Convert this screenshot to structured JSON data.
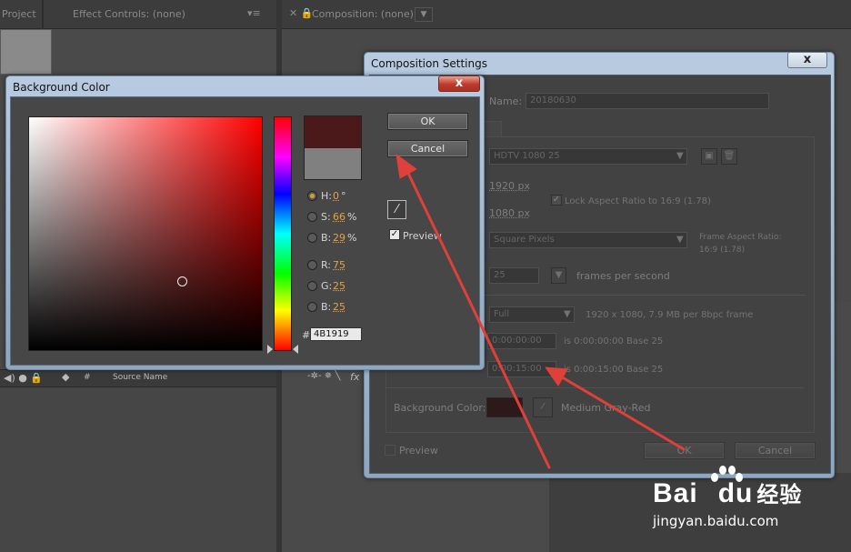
{
  "app": {
    "tabs": {
      "project": "Project",
      "effect_controls": "Effect Controls: (none)",
      "composition": "Composition: (none)"
    },
    "timeline": {
      "hash": "#",
      "source_name": "Source Name",
      "fx": "fx"
    }
  },
  "comp_settings": {
    "title": "Composition Settings",
    "close": "x",
    "name_label": "Name:",
    "name_value": "20180630",
    "preset": "HDTV 1080 25",
    "width": "1920 px",
    "height": "1080 px",
    "lock_aspect": "Lock Aspect Ratio to 16:9 (1.78)",
    "pixel_aspect": "Square Pixels",
    "frame_aspect_label": "Frame Aspect Ratio:",
    "frame_aspect_value": "16:9 (1.78)",
    "frame_rate": "25",
    "fps_label": "frames per second",
    "resolution": "Full",
    "resolution_info": "1920 x 1080, 7.9 MB per 8bpc frame",
    "start_tc": "0:00:00:00",
    "start_info": "is 0:00:00:00  Base 25",
    "duration_tc": "0:00:15:00",
    "duration_info": "is 0:00:15:00  Base 25",
    "bg_label": "Background Color:",
    "bg_name": "Medium Gray-Red",
    "preview": "Preview",
    "ok": "OK",
    "cancel": "Cancel"
  },
  "bg_color": {
    "title": "Background Color",
    "close": "x",
    "ok": "OK",
    "cancel": "Cancel",
    "preview": "Preview",
    "hex_prefix": "#",
    "hex": "4B1919",
    "h_label": "H:",
    "h_value": "0",
    "h_unit": "°",
    "s_label": "S:",
    "s_value": "66",
    "s_unit": "%",
    "b_label": "B:",
    "b_value": "29",
    "b_unit": "%",
    "r_label": "R:",
    "r_value": "75",
    "g_label": "G:",
    "g_value": "25",
    "b2_label": "B:",
    "b2_value": "25"
  },
  "watermark": {
    "brand": "Bai",
    "brand2": "du",
    "suffix": "经验",
    "url": "jingyan.baidu.com"
  },
  "colors": {
    "new_color": "#4B1919",
    "old_color": "#808080",
    "arrow": "#e0403a"
  }
}
